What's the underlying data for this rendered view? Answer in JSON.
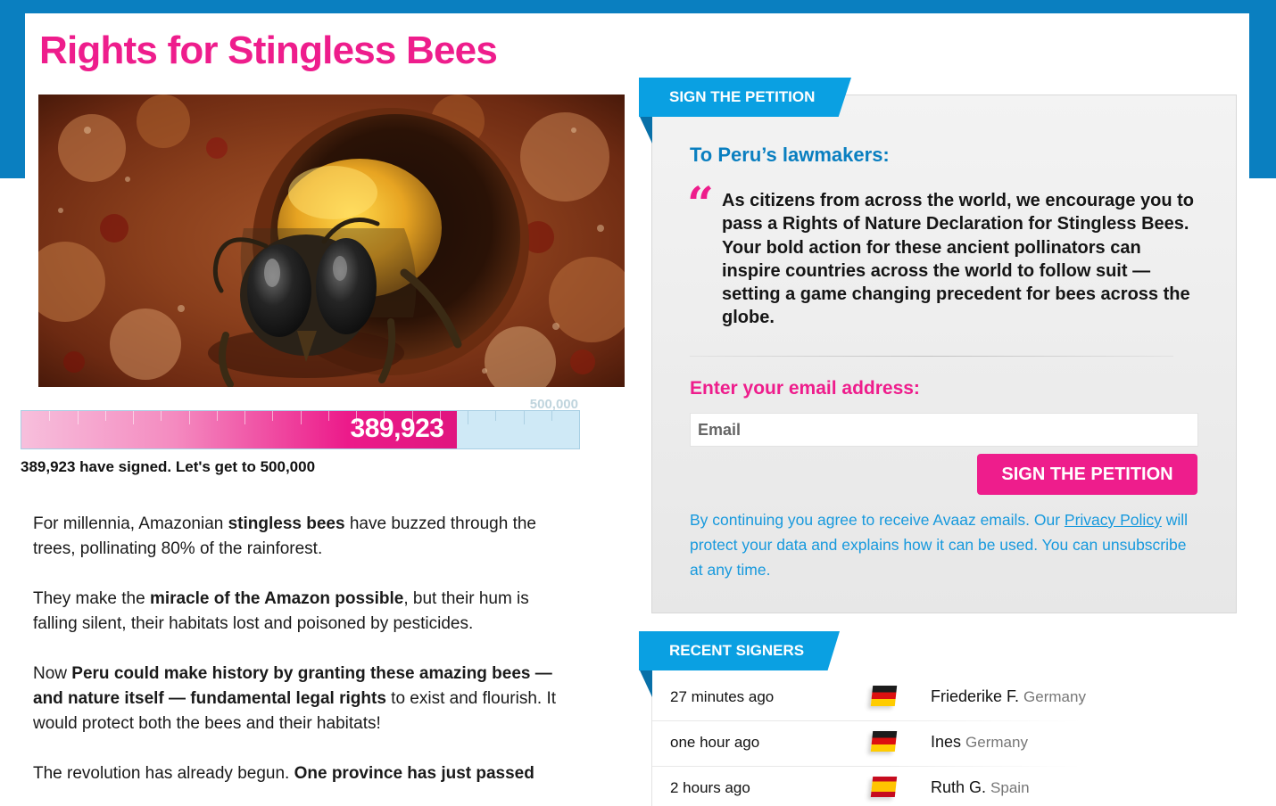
{
  "colors": {
    "brand_pink": "#ee1d8c",
    "brand_blue": "#0a7fc0",
    "ribbon_blue": "#0aa0e2"
  },
  "page": {
    "title": "Rights for Stingless Bees"
  },
  "progress": {
    "goal_label": "500,000",
    "count_label": "389,923",
    "fraction": 0.78,
    "caption": "389,923 have signed. Let's get to 500,000"
  },
  "body": {
    "p1": {
      "t1": "For millennia, Amazonian ",
      "b1": "stingless bees",
      "t2": " have buzzed through the trees, pollinating 80% of the rainforest."
    },
    "p2": {
      "t1": "They make the ",
      "b1": "miracle of the Amazon possible",
      "t2": ", but their hum is falling silent, their habitats lost and poisoned by pesticides."
    },
    "p3": {
      "t1": "Now ",
      "b1": "Peru could make history by granting these amazing bees — and nature itself — fundamental legal rights",
      "t2": " to exist and flourish. It would protect both the bees and their habitats!"
    },
    "p4": {
      "t1": "The revolution has already begun. ",
      "b1": "One province has just passed"
    }
  },
  "petition": {
    "ribbon": "SIGN THE PETITION",
    "to_line": "To Peru’s lawmakers:",
    "quote_mark": "“",
    "quote": "As citizens from across the world, we encourage you to pass a Rights of Nature Declaration for Stingless Bees. Your bold action for these ancient pollinators can inspire countries across the world to follow suit — setting a game changing precedent for bees across the globe.",
    "email_label": "Enter your email address:",
    "email_placeholder": "Email",
    "email_value": "",
    "button_label": "SIGN THE PETITION",
    "disclaimer_before": "By continuing you agree to receive Avaaz emails. Our ",
    "disclaimer_link": "Privacy Policy",
    "disclaimer_after": " will protect your data and explains how it can be used. You can unsubscribe at any time."
  },
  "signers": {
    "ribbon": "RECENT SIGNERS",
    "rows": [
      {
        "time": "27 minutes ago",
        "flag": "germany-flag",
        "name": "Friederike F.",
        "country": "Germany"
      },
      {
        "time": "one hour ago",
        "flag": "germany-flag",
        "name": "Ines",
        "country": "Germany"
      },
      {
        "time": "2 hours ago",
        "flag": "spain-flag",
        "name": "Ruth G.",
        "country": "Spain"
      }
    ]
  }
}
